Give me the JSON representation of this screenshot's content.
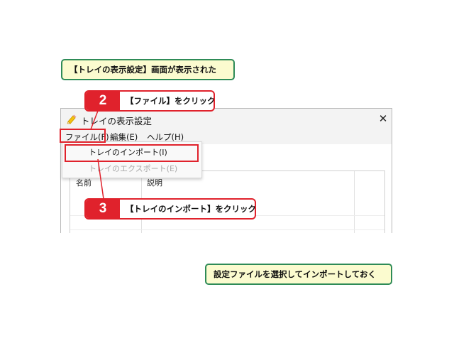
{
  "notes": {
    "top": "【トレイの表示設定】画面が表示された",
    "bottom": "設定ファイルを選択してインポートしておく"
  },
  "window": {
    "title": "トレイの表示設定",
    "close_glyph": "✕",
    "app_icon": "tray-pencil-icon"
  },
  "menubar": {
    "file": "ファイル(F)",
    "edit": "編集(E)",
    "help": "ヘルプ(H)"
  },
  "file_menu": {
    "import": "トレイのインポート(I)",
    "export": "トレイのエクスポート(E)"
  },
  "table": {
    "columns": [
      "名前",
      "説明"
    ]
  },
  "callouts": [
    {
      "number": "2",
      "text": "【ファイル】をクリック"
    },
    {
      "number": "3",
      "text": "【トレイのインポート】をクリック"
    }
  ],
  "colors": {
    "accent_red": "#e0222c",
    "note_border": "#2e8b57",
    "note_fill": "#fbfbcf"
  }
}
